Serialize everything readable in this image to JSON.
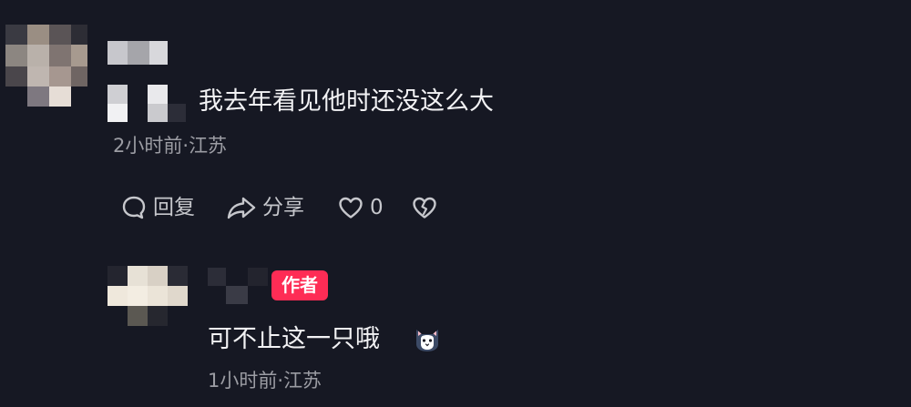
{
  "comment": {
    "text": "我去年看见他时还没这么大",
    "time": "2小时前",
    "location": "江苏",
    "actions": {
      "reply_label": "回复",
      "share_label": "分享",
      "like_count": "0"
    }
  },
  "reply": {
    "badge": "作者",
    "text": "可不止这一只哦",
    "time": "1小时前",
    "location": "江苏"
  },
  "colors": {
    "background": "#161823",
    "text_primary": "#f2f2f4",
    "text_secondary": "#9b9ca3",
    "badge": "#fe2c55"
  },
  "icons": [
    "comment-bubble-icon",
    "share-arrow-icon",
    "heart-icon",
    "broken-heart-icon",
    "cat-emoji-icon"
  ]
}
